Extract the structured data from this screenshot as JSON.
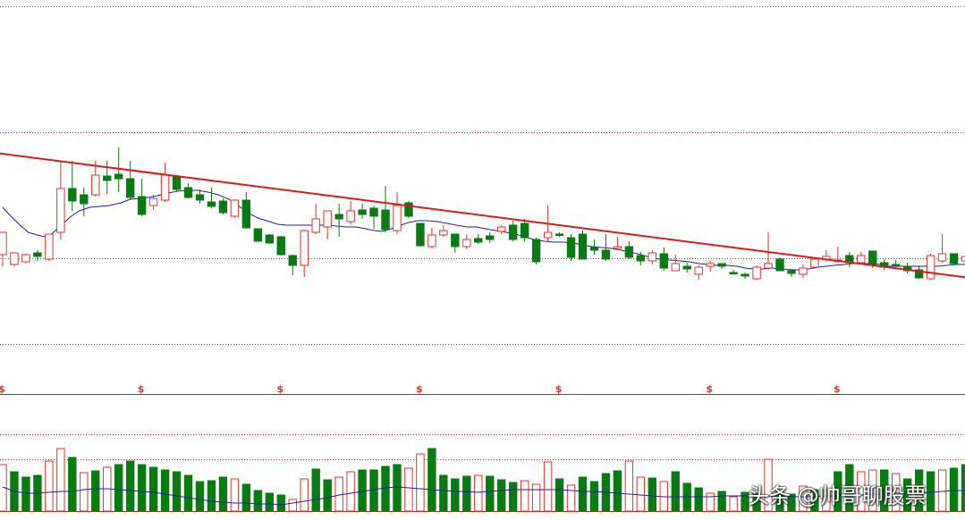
{
  "watermark": "头条 @帅哥聊股票",
  "marker_symbol": "$",
  "colors": {
    "up": "#e8322b",
    "down": "#0a7a12",
    "ma": "#1f1fb4",
    "trend": "#e01818",
    "grid": "#cc3333",
    "divider": "#cc2222"
  },
  "chart_data": {
    "type": "candlestick",
    "grid": true,
    "candles": [
      [
        0,
        285,
        260,
        298,
        275
      ],
      [
        1,
        296,
        283,
        298,
        284
      ],
      [
        2,
        293,
        285,
        295,
        284
      ],
      [
        3,
        283,
        287,
        292,
        280
      ],
      [
        4,
        290,
        262,
        292,
        262
      ],
      [
        5,
        260,
        211,
        268,
        180
      ],
      [
        6,
        211,
        225,
        236,
        180
      ],
      [
        7,
        218,
        228,
        242,
        210
      ],
      [
        8,
        218,
        196,
        220,
        180
      ],
      [
        9,
        197,
        202,
        217,
        180
      ],
      [
        10,
        195,
        200,
        215,
        165
      ],
      [
        11,
        200,
        221,
        224,
        180
      ],
      [
        12,
        220,
        240,
        242,
        200
      ],
      [
        13,
        230,
        222,
        235,
        218
      ],
      [
        14,
        224,
        196,
        226,
        182
      ],
      [
        15,
        197,
        212,
        215,
        197
      ],
      [
        16,
        210,
        221,
        222,
        205
      ],
      [
        17,
        218,
        224,
        228,
        212
      ],
      [
        18,
        226,
        231,
        233,
        210
      ],
      [
        19,
        225,
        238,
        240,
        222
      ],
      [
        20,
        242,
        224,
        244,
        224
      ],
      [
        21,
        224,
        255,
        256,
        215
      ],
      [
        22,
        256,
        270,
        270,
        256
      ],
      [
        23,
        263,
        272,
        273,
        262
      ],
      [
        24,
        265,
        285,
        286,
        264
      ],
      [
        25,
        286,
        297,
        308,
        285
      ],
      [
        26,
        297,
        258,
        310,
        257
      ],
      [
        27,
        260,
        245,
        262,
        228
      ],
      [
        28,
        254,
        236,
        268,
        236
      ],
      [
        29,
        240,
        245,
        265,
        228
      ],
      [
        30,
        248,
        236,
        251,
        225
      ],
      [
        31,
        235,
        240,
        245,
        228
      ],
      [
        32,
        233,
        242,
        256,
        230
      ],
      [
        33,
        235,
        257,
        260,
        208
      ],
      [
        34,
        258,
        230,
        262,
        215
      ],
      [
        35,
        227,
        242,
        244,
        225
      ],
      [
        36,
        250,
        275,
        276,
        250
      ],
      [
        37,
        276,
        263,
        278,
        255
      ],
      [
        38,
        263,
        258,
        265,
        252
      ],
      [
        39,
        262,
        276,
        283,
        262
      ],
      [
        40,
        276,
        268,
        279,
        262
      ],
      [
        41,
        267,
        271,
        273,
        262
      ],
      [
        42,
        264,
        268,
        272,
        260
      ],
      [
        43,
        259,
        254,
        262,
        252
      ],
      [
        44,
        252,
        268,
        270,
        247
      ],
      [
        45,
        250,
        266,
        270,
        245
      ],
      [
        46,
        268,
        293,
        296,
        266
      ],
      [
        47,
        266,
        260,
        270,
        230
      ],
      [
        48,
        262,
        262,
        265,
        260
      ],
      [
        49,
        266,
        288,
        292,
        262
      ],
      [
        50,
        262,
        290,
        290,
        258
      ],
      [
        51,
        277,
        280,
        285,
        268
      ],
      [
        52,
        280,
        290,
        292,
        262
      ],
      [
        53,
        278,
        276,
        280,
        265
      ],
      [
        54,
        276,
        288,
        290,
        270
      ],
      [
        55,
        286,
        292,
        297,
        282
      ],
      [
        56,
        292,
        283,
        296,
        280
      ],
      [
        57,
        284,
        300,
        303,
        277
      ],
      [
        58,
        303,
        295,
        303,
        285
      ],
      [
        59,
        298,
        301,
        305,
        294
      ],
      [
        60,
        307,
        299,
        313,
        297
      ],
      [
        61,
        298,
        295,
        304,
        292
      ],
      [
        62,
        295,
        298,
        301,
        295
      ],
      [
        63,
        305,
        305,
        307,
        302
      ],
      [
        64,
        307,
        309,
        312,
        305
      ],
      [
        65,
        312,
        299,
        313,
        297
      ],
      [
        66,
        300,
        295,
        302,
        260
      ],
      [
        67,
        290,
        303,
        303,
        288
      ],
      [
        68,
        303,
        306,
        310,
        301
      ],
      [
        69,
        307,
        300,
        311,
        296
      ],
      [
        70,
        299,
        290,
        301,
        290
      ],
      [
        71,
        290,
        287,
        293,
        280
      ],
      [
        72,
        292,
        291,
        294,
        276
      ],
      [
        73,
        286,
        294,
        299,
        282
      ],
      [
        74,
        294,
        286,
        296,
        282
      ],
      [
        75,
        281,
        297,
        300,
        281
      ],
      [
        76,
        294,
        299,
        302,
        290
      ],
      [
        77,
        296,
        297,
        300,
        291
      ],
      [
        78,
        298,
        303,
        306,
        294
      ],
      [
        79,
        302,
        311,
        312,
        297
      ],
      [
        80,
        312,
        286,
        313,
        284
      ],
      [
        81,
        292,
        284,
        294,
        262
      ],
      [
        82,
        284,
        295,
        297,
        284
      ],
      [
        83,
        292,
        287,
        295,
        280
      ],
      [
        84,
        290,
        283,
        293,
        283
      ],
      [
        85,
        286,
        265,
        286,
        235
      ],
      [
        86,
        265,
        240,
        265,
        240
      ]
    ],
    "ma_line": [
      [
        0,
        232
      ],
      [
        0.7,
        242
      ],
      [
        1.5,
        252
      ],
      [
        2.2,
        260
      ],
      [
        3,
        263
      ],
      [
        3.6,
        265
      ],
      [
        4.2,
        262
      ],
      [
        5,
        253
      ],
      [
        5.8,
        243
      ],
      [
        6.6,
        236
      ],
      [
        7.5,
        232
      ],
      [
        8.4,
        231
      ],
      [
        9.2,
        230
      ],
      [
        10.2,
        227
      ],
      [
        11,
        223
      ],
      [
        12,
        222
      ],
      [
        13,
        220
      ],
      [
        14,
        217
      ],
      [
        15,
        214
      ],
      [
        16,
        213
      ],
      [
        16.8,
        213
      ],
      [
        17.7,
        215
      ],
      [
        18.6,
        218
      ],
      [
        19.5,
        223
      ],
      [
        20.3,
        230
      ],
      [
        21.1,
        238
      ],
      [
        22,
        244
      ],
      [
        23,
        248
      ],
      [
        23.7,
        251
      ],
      [
        24.5,
        252
      ],
      [
        25.3,
        252
      ],
      [
        26.2,
        252
      ],
      [
        27,
        252
      ],
      [
        28,
        252
      ],
      [
        28.8,
        253
      ],
      [
        29.6,
        254
      ],
      [
        30.4,
        254
      ],
      [
        31.3,
        256
      ],
      [
        32,
        258
      ],
      [
        32.7,
        259
      ],
      [
        33.5,
        256
      ],
      [
        34.3,
        252
      ],
      [
        35,
        249
      ],
      [
        35.8,
        247
      ],
      [
        36.6,
        247
      ],
      [
        37.5,
        248
      ],
      [
        38.3,
        250
      ],
      [
        39.1,
        252
      ],
      [
        40,
        254
      ],
      [
        40.8,
        254
      ],
      [
        41.6,
        256
      ],
      [
        42.5,
        258
      ],
      [
        43.4,
        260
      ],
      [
        44.2,
        262
      ],
      [
        45,
        265
      ],
      [
        45.8,
        268
      ],
      [
        46.7,
        270
      ],
      [
        47.5,
        271
      ],
      [
        48.4,
        271
      ],
      [
        49.1,
        272
      ],
      [
        50,
        274
      ],
      [
        50.8,
        276
      ],
      [
        51.6,
        277
      ],
      [
        52.5,
        278
      ],
      [
        53.3,
        280
      ],
      [
        54.1,
        282
      ],
      [
        55,
        285
      ],
      [
        55.8,
        288
      ],
      [
        56.6,
        290
      ],
      [
        57.5,
        291
      ],
      [
        58.4,
        292
      ],
      [
        59.2,
        293
      ],
      [
        60,
        295
      ],
      [
        60.8,
        296
      ],
      [
        61.6,
        297
      ],
      [
        62.5,
        297
      ],
      [
        63.3,
        298
      ],
      [
        64,
        300
      ],
      [
        64.8,
        301
      ],
      [
        65.5,
        301
      ],
      [
        66.3,
        300
      ],
      [
        67.2,
        301
      ],
      [
        68,
        302
      ],
      [
        68.7,
        302
      ],
      [
        69.5,
        301
      ],
      [
        70.3,
        299
      ],
      [
        71,
        298
      ],
      [
        71.7,
        297
      ],
      [
        72.5,
        296
      ],
      [
        73.3,
        295
      ],
      [
        74,
        295
      ],
      [
        74.9,
        295
      ],
      [
        75.6,
        296
      ],
      [
        76.4,
        298
      ],
      [
        77.3,
        298
      ],
      [
        78.1,
        298
      ],
      [
        79,
        298
      ],
      [
        79.8,
        298
      ],
      [
        80.6,
        298
      ],
      [
        81.4,
        297
      ],
      [
        82.2,
        296
      ],
      [
        83,
        296
      ],
      [
        84,
        295
      ],
      [
        84.8,
        294
      ],
      [
        85.6,
        291
      ],
      [
        86.3,
        288
      ]
    ],
    "trendline": [
      [
        -6.1,
        162
      ],
      [
        78.6,
        303
      ]
    ],
    "volume": [
      [
        0,
        52,
        0
      ],
      [
        1,
        44,
        1
      ],
      [
        2,
        38,
        1
      ],
      [
        3,
        40,
        1
      ],
      [
        4,
        56,
        0
      ],
      [
        5,
        70,
        0
      ],
      [
        6,
        60,
        1
      ],
      [
        7,
        43,
        0
      ],
      [
        8,
        45,
        1
      ],
      [
        9,
        49,
        0
      ],
      [
        10,
        52,
        1
      ],
      [
        11,
        56,
        1
      ],
      [
        12,
        52,
        1
      ],
      [
        13,
        49,
        1
      ],
      [
        14,
        46,
        1
      ],
      [
        15,
        44,
        1
      ],
      [
        16,
        40,
        1
      ],
      [
        17,
        33,
        1
      ],
      [
        18,
        34,
        1
      ],
      [
        19,
        38,
        1
      ],
      [
        20,
        36,
        0
      ],
      [
        21,
        30,
        1
      ],
      [
        22,
        23,
        1
      ],
      [
        23,
        20,
        1
      ],
      [
        24,
        18,
        1
      ],
      [
        25,
        13,
        0
      ],
      [
        26,
        36,
        0
      ],
      [
        27,
        47,
        1
      ],
      [
        28,
        35,
        1
      ],
      [
        29,
        38,
        0
      ],
      [
        30,
        44,
        0
      ],
      [
        31,
        46,
        1
      ],
      [
        32,
        46,
        1
      ],
      [
        33,
        50,
        1
      ],
      [
        34,
        52,
        1
      ],
      [
        35,
        48,
        0
      ],
      [
        36,
        64,
        0
      ],
      [
        37,
        70,
        1
      ],
      [
        38,
        40,
        1
      ],
      [
        39,
        36,
        1
      ],
      [
        40,
        39,
        1
      ],
      [
        41,
        40,
        0
      ],
      [
        42,
        39,
        1
      ],
      [
        43,
        35,
        1
      ],
      [
        44,
        32,
        1
      ],
      [
        45,
        34,
        0
      ],
      [
        46,
        30,
        0
      ],
      [
        47,
        55,
        0
      ],
      [
        48,
        36,
        1
      ],
      [
        49,
        29,
        0
      ],
      [
        50,
        38,
        1
      ],
      [
        51,
        33,
        1
      ],
      [
        52,
        42,
        1
      ],
      [
        53,
        45,
        1
      ],
      [
        54,
        56,
        0
      ],
      [
        55,
        38,
        0
      ],
      [
        56,
        37,
        1
      ],
      [
        57,
        33,
        0
      ],
      [
        58,
        44,
        1
      ],
      [
        59,
        31,
        1
      ],
      [
        60,
        26,
        1
      ],
      [
        61,
        20,
        0
      ],
      [
        62,
        22,
        1
      ],
      [
        63,
        16,
        0
      ],
      [
        64,
        21,
        1
      ],
      [
        65,
        20,
        1
      ],
      [
        66,
        58,
        0
      ],
      [
        67,
        22,
        1
      ],
      [
        68,
        19,
        1
      ],
      [
        69,
        28,
        0
      ],
      [
        70,
        24,
        1
      ],
      [
        71,
        23,
        0
      ],
      [
        72,
        44,
        1
      ],
      [
        73,
        52,
        1
      ],
      [
        74,
        44,
        0
      ],
      [
        75,
        46,
        0
      ],
      [
        76,
        46,
        1
      ],
      [
        77,
        42,
        0
      ],
      [
        78,
        36,
        1
      ],
      [
        79,
        46,
        1
      ],
      [
        80,
        44,
        1
      ],
      [
        81,
        46,
        0
      ],
      [
        82,
        48,
        1
      ],
      [
        83,
        52,
        1
      ],
      [
        84,
        55,
        1
      ],
      [
        85,
        46,
        0
      ],
      [
        86,
        72,
        0
      ]
    ],
    "volume_ma": [
      [
        0,
        27
      ],
      [
        1,
        22
      ],
      [
        2,
        20
      ],
      [
        3,
        20
      ],
      [
        4,
        21
      ],
      [
        5,
        22
      ],
      [
        6,
        22
      ],
      [
        7,
        24
      ],
      [
        8,
        25
      ],
      [
        9,
        25
      ],
      [
        10,
        24
      ],
      [
        11,
        23
      ],
      [
        12,
        22
      ],
      [
        13,
        21
      ],
      [
        14,
        19
      ],
      [
        15,
        17
      ],
      [
        16,
        15
      ],
      [
        17,
        13
      ],
      [
        18,
        11
      ],
      [
        19,
        10
      ],
      [
        20,
        9
      ],
      [
        21,
        9
      ],
      [
        22,
        8
      ],
      [
        23,
        8
      ],
      [
        24,
        7
      ],
      [
        25,
        9
      ],
      [
        26,
        11
      ],
      [
        27,
        13
      ],
      [
        28,
        15
      ],
      [
        29,
        18
      ],
      [
        30,
        20
      ],
      [
        31,
        22
      ],
      [
        32,
        24
      ],
      [
        33,
        26
      ],
      [
        34,
        27
      ],
      [
        35,
        26
      ],
      [
        36,
        25
      ],
      [
        37,
        24
      ],
      [
        38,
        23
      ],
      [
        39,
        22
      ],
      [
        40,
        22
      ],
      [
        41,
        21
      ],
      [
        42,
        22
      ],
      [
        43,
        23
      ],
      [
        44,
        24
      ],
      [
        45,
        24
      ],
      [
        46,
        24
      ],
      [
        47,
        24
      ],
      [
        48,
        24
      ],
      [
        49,
        23
      ],
      [
        50,
        22
      ],
      [
        51,
        22
      ],
      [
        52,
        21
      ],
      [
        53,
        20
      ],
      [
        54,
        19
      ],
      [
        55,
        18
      ],
      [
        56,
        17
      ],
      [
        57,
        16
      ],
      [
        58,
        16
      ],
      [
        59,
        16
      ],
      [
        60,
        16
      ],
      [
        61,
        16
      ],
      [
        62,
        17
      ],
      [
        63,
        17
      ],
      [
        64,
        17
      ],
      [
        65,
        17
      ],
      [
        66,
        17
      ],
      [
        67,
        16
      ],
      [
        68,
        16
      ],
      [
        69,
        16
      ],
      [
        70,
        16
      ],
      [
        71,
        17
      ],
      [
        72,
        17
      ],
      [
        73,
        18
      ],
      [
        74,
        18
      ],
      [
        75,
        19
      ],
      [
        76,
        19
      ],
      [
        77,
        20
      ],
      [
        78,
        20
      ],
      [
        79,
        20
      ],
      [
        80,
        21
      ],
      [
        81,
        22
      ],
      [
        82,
        23
      ],
      [
        83,
        23
      ],
      [
        84,
        24
      ],
      [
        85,
        25
      ],
      [
        86,
        27
      ]
    ],
    "markers": [
      0,
      12,
      24,
      36,
      48,
      61,
      72
    ]
  }
}
